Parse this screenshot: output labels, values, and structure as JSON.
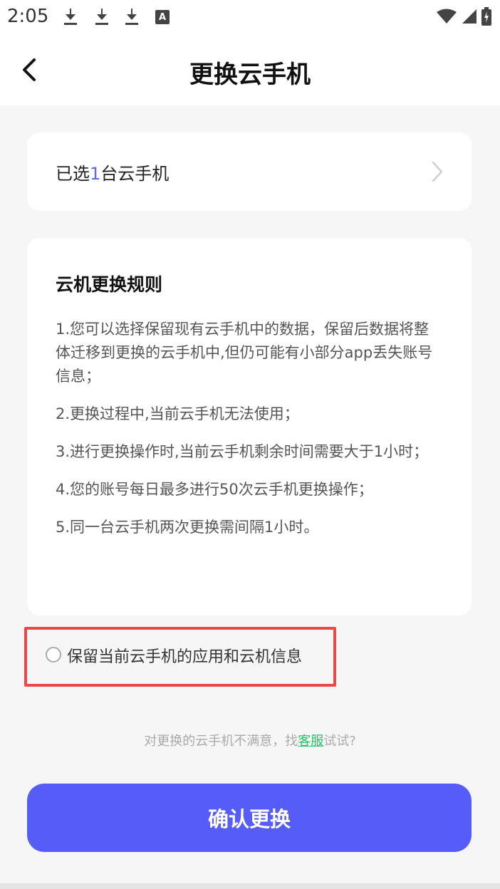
{
  "status_bar": {
    "time": "2:05",
    "icons": [
      "download-icon",
      "download-icon",
      "download-icon",
      "a-notification-icon",
      "wifi-icon",
      "signal-icon",
      "battery-charging-icon"
    ],
    "a_icon_letter": "A"
  },
  "header": {
    "title": "更换云手机",
    "back_icon": "chevron-left-icon"
  },
  "selection": {
    "prefix": "已选",
    "count": "1",
    "suffix": "台云手机",
    "chevron_icon": "chevron-right-icon"
  },
  "rules": {
    "title": "云机更换规则",
    "items": [
      "1.您可以选择保留现有云手机中的数据，保留后数据将整体迁移到更换的云手机中,但仍可能有小部分app丢失账号信息；",
      "2.更换过程中,当前云手机无法使用；",
      "3.进行更换操作时,当前云手机剩余时间需要大于1小时；",
      "4.您的账号每日最多进行50次云手机更换操作；",
      "5.同一台云手机两次更换需间隔1小时。"
    ]
  },
  "keep_option": {
    "label": "保留当前云手机的应用和云机信息",
    "checked": false
  },
  "support": {
    "prefix": "对更换的云手机不满意，找",
    "link": "客服",
    "suffix": "试试?"
  },
  "confirm_button": {
    "label": "确认更换"
  },
  "colors": {
    "accent": "#555cf7",
    "highlight_border": "#e8494b",
    "link": "#22c36a",
    "count": "#5b67f5"
  }
}
